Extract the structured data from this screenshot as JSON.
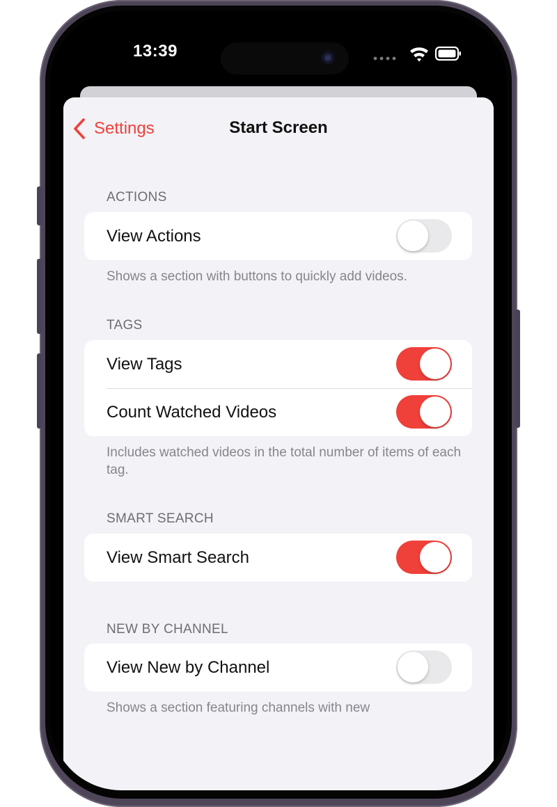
{
  "status_bar": {
    "time": "13:39"
  },
  "nav": {
    "back_label": "Settings",
    "title": "Start Screen"
  },
  "sections": {
    "actions": {
      "header": "ACTIONS",
      "rows": [
        {
          "label": "View Actions",
          "toggle_on": false
        }
      ],
      "footer": "Shows a section with buttons to quickly add videos."
    },
    "tags": {
      "header": "TAGS",
      "rows": [
        {
          "label": "View Tags",
          "toggle_on": true
        },
        {
          "label": "Count Watched Videos",
          "toggle_on": true
        }
      ],
      "footer": "Includes watched videos in the total number of items of each tag."
    },
    "smart_search": {
      "header": "SMART SEARCH",
      "rows": [
        {
          "label": "View Smart Search",
          "toggle_on": true
        }
      ]
    },
    "new_by_channel": {
      "header": "NEW BY CHANNEL",
      "rows": [
        {
          "label": "View New by Channel",
          "toggle_on": false
        }
      ],
      "footer": "Shows a section featuring channels with new"
    }
  },
  "colors": {
    "accent": "#f0403a",
    "background": "#f2f2f7",
    "toggle_off": "#e9e9eb"
  }
}
